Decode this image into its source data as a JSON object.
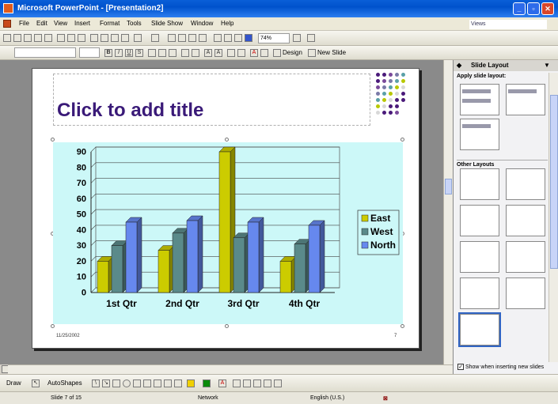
{
  "window": {
    "title": "Microsoft PowerPoint - [Presentation2]"
  },
  "menu": [
    "File",
    "Edit",
    "View",
    "Insert",
    "Format",
    "Tools",
    "Slide Show",
    "Window",
    "Help"
  ],
  "views_box": "Views",
  "toolbar": {
    "zoom": "74%",
    "design_label": "Design",
    "new_slide_label": "New Slide"
  },
  "slide": {
    "title_placeholder": "Click to add title",
    "date": "11/25/2002",
    "page_number": "7"
  },
  "panel": {
    "title": "Slide Layout",
    "apply_label": "Apply slide layout:",
    "other_layouts_label": "Other Layouts",
    "show_when_inserting": "Show when inserting new slides"
  },
  "draw_toolbar": {
    "draw_label": "Draw",
    "autoshapes_label": "AutoShapes"
  },
  "status": {
    "slide": "Slide 7 of 15",
    "template": "Network",
    "language": "English (U.S.)"
  },
  "colors": {
    "east": "#cccc00",
    "west": "#5a8a8a",
    "north": "#6688ee",
    "title": "#3a1a78",
    "chart_bg": "#ccf8f8"
  },
  "chart_data": {
    "type": "bar",
    "categories": [
      "1st Qtr",
      "2nd Qtr",
      "3rd Qtr",
      "4th Qtr"
    ],
    "series": [
      {
        "name": "East",
        "values": [
          20,
          27,
          90,
          20
        ]
      },
      {
        "name": "West",
        "values": [
          30,
          38,
          35,
          31
        ]
      },
      {
        "name": "North",
        "values": [
          45,
          46,
          45,
          43
        ]
      }
    ],
    "ylim": [
      0,
      90
    ],
    "yticks": [
      "0",
      "10",
      "20",
      "30",
      "40",
      "50",
      "60",
      "70",
      "80",
      "90"
    ],
    "legend": "right",
    "grid": true
  }
}
